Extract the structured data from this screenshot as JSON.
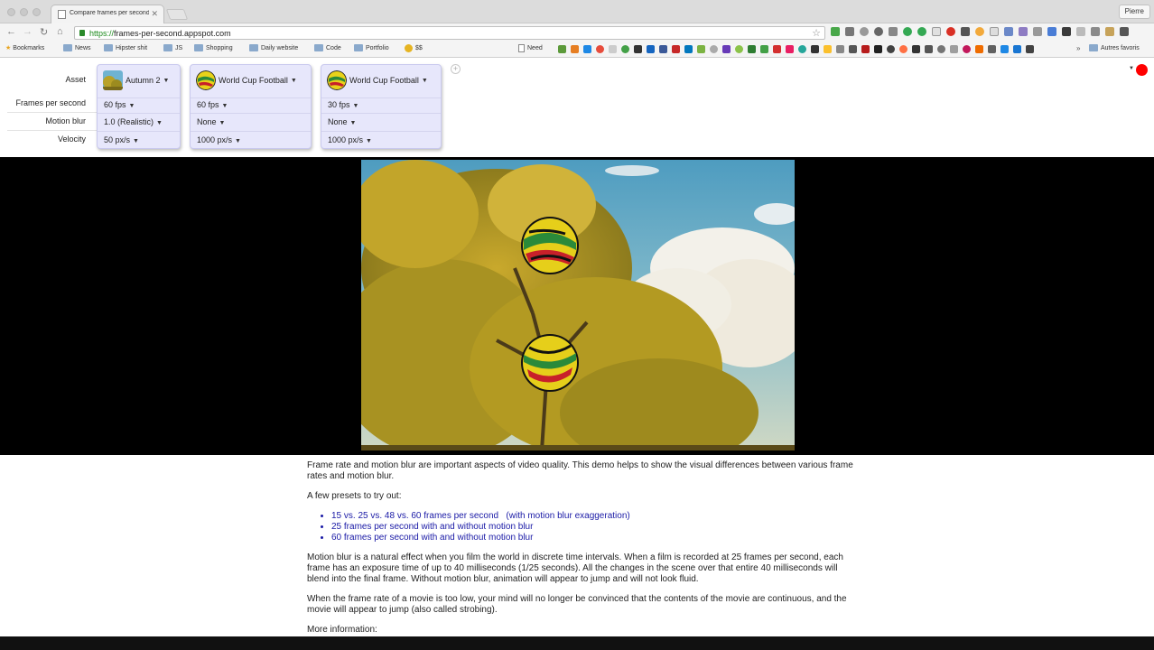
{
  "browser": {
    "tab_title": "Compare frames per second",
    "tab_close": "✕",
    "profile_label": "Pierre",
    "url_scheme": "https://",
    "url_host": "frames-per-second.appspot.com",
    "bookmarks": [
      "Bookmarks",
      "News",
      "Hipster shit",
      "JS",
      "Shopping",
      "Daily website",
      "Code",
      "Portfolio",
      "$$",
      "Need"
    ],
    "other_bookmarks": "Autres favoris",
    "more_glyph": "»"
  },
  "controls": {
    "row_labels": {
      "asset": "Asset",
      "fps": "Frames per second",
      "motion_blur": "Motion blur",
      "velocity": "Velocity"
    },
    "columns": [
      {
        "asset": "Autumn 2",
        "fps": "60 fps",
        "motion_blur": "1.0 (Realistic)",
        "velocity": "50 px/s"
      },
      {
        "asset": "World Cup Football",
        "fps": "60 fps",
        "motion_blur": "None",
        "velocity": "1000 px/s"
      },
      {
        "asset": "World Cup Football",
        "fps": "30 fps",
        "motion_blur": "None",
        "velocity": "1000 px/s"
      }
    ],
    "add_glyph": "+",
    "menu_glyph": "▼"
  },
  "colors": {
    "panel_bg": "#e7e7fb",
    "link": "#1a1aa6",
    "record": "#ff0000",
    "sky": "#5aa2c4",
    "foliage": "#b39a22"
  },
  "article": {
    "intro": "Frame rate and motion blur are important aspects of video quality. This demo helps to show the visual differences between various frame rates and motion blur.",
    "presets_heading": "A few presets to try out:",
    "presets": [
      "15 vs. 25 vs. 48 vs. 60 frames per second   (with motion blur exaggeration)",
      "25 frames per second with and without motion blur",
      "60 frames per second with and without motion blur"
    ],
    "motion_blur_text": "Motion blur is a natural effect when you film the world in discrete time intervals. When a film is recorded at 25 frames per second, each frame has an exposure time of up to 40 milliseconds (1/25 seconds). All the changes in the scene over that entire 40 milliseconds will blend into the final frame. Without motion blur, animation will appear to jump and will not look fluid.",
    "frame_rate_text": "When the frame rate of a movie is too low, your mind will no longer be convinced that the contents of the movie are continuous, and the movie will appear to jump (also called strobing).",
    "more_info": "More information:"
  }
}
